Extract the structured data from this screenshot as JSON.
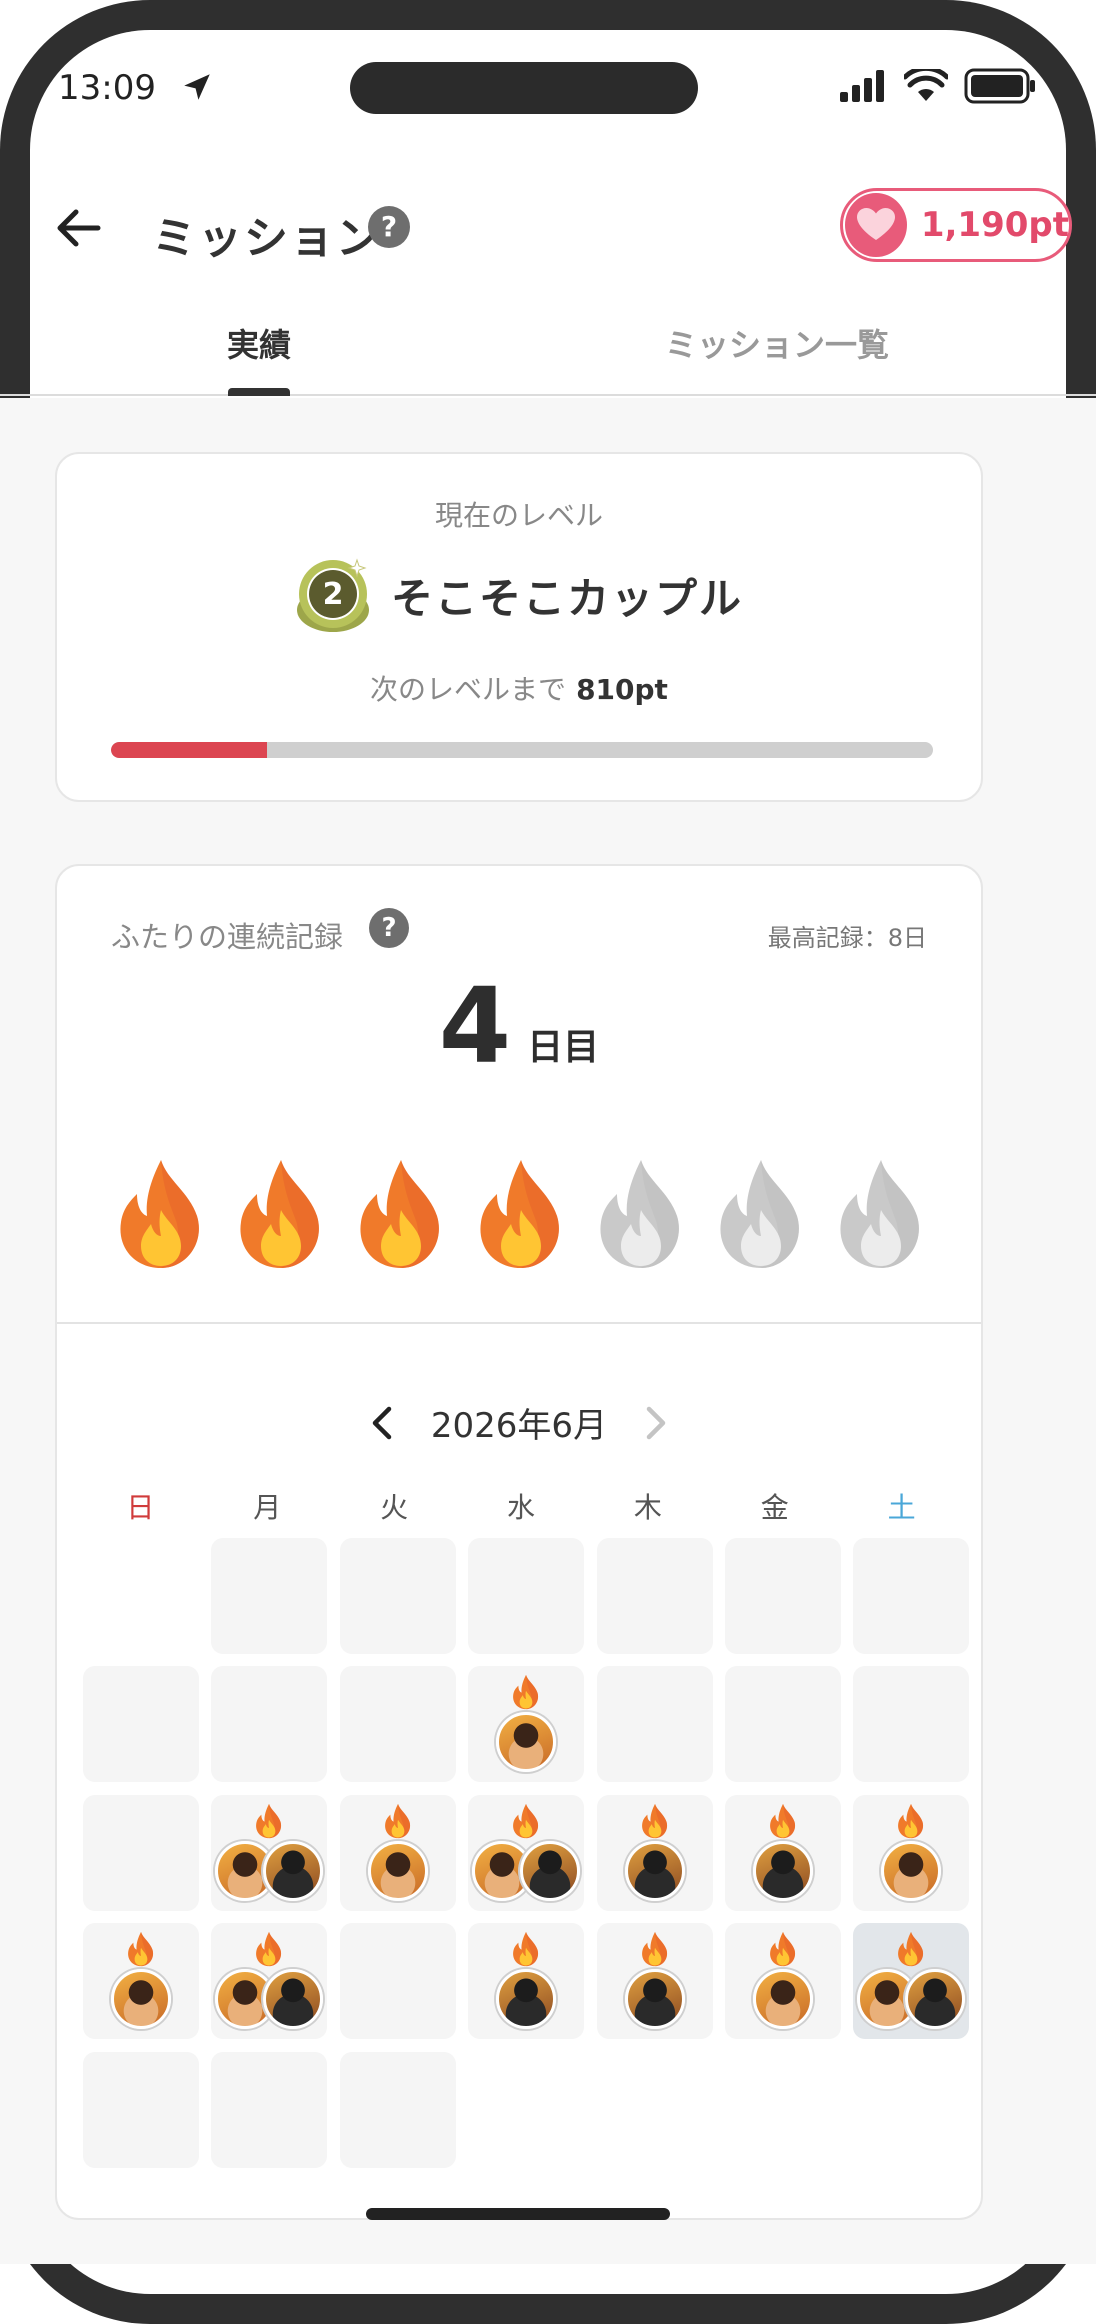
{
  "status_bar": {
    "time": "13:09"
  },
  "header": {
    "title": "ミッション",
    "help_glyph": "?",
    "points": "1,190pt"
  },
  "tabs": [
    {
      "label": "実績",
      "active": true
    },
    {
      "label": "ミッション一覧",
      "active": false
    }
  ],
  "level": {
    "caption": "現在のレベル",
    "number": "2",
    "name": "そこそこカップル",
    "next_label": "次のレベルまで",
    "next_value": "810pt",
    "progress_fraction": 0.19
  },
  "streak": {
    "label": "ふたりの連続記録",
    "help_glyph": "?",
    "best_record": "最高記録：8日",
    "count": "4",
    "unit": "日目",
    "flames": [
      true,
      true,
      true,
      true,
      false,
      false,
      false
    ]
  },
  "calendar": {
    "title": "2026年6月",
    "weekdays": [
      "日",
      "月",
      "火",
      "水",
      "木",
      "金",
      "土"
    ],
    "weeks": [
      [
        null,
        {
          "flame": false,
          "avatars": []
        },
        {
          "flame": false,
          "avatars": []
        },
        {
          "flame": false,
          "avatars": []
        },
        {
          "flame": false,
          "avatars": []
        },
        {
          "flame": false,
          "avatars": []
        },
        {
          "flame": false,
          "avatars": []
        }
      ],
      [
        {
          "flame": false,
          "avatars": []
        },
        {
          "flame": false,
          "avatars": []
        },
        {
          "flame": false,
          "avatars": []
        },
        {
          "flame": true,
          "avatars": [
            "f"
          ]
        },
        {
          "flame": false,
          "avatars": []
        },
        {
          "flame": false,
          "avatars": []
        },
        {
          "flame": false,
          "avatars": []
        }
      ],
      [
        {
          "flame": false,
          "avatars": []
        },
        {
          "flame": true,
          "avatars": [
            "f",
            "m"
          ]
        },
        {
          "flame": true,
          "avatars": [
            "f"
          ]
        },
        {
          "flame": true,
          "avatars": [
            "f",
            "m"
          ]
        },
        {
          "flame": true,
          "avatars": [
            "m"
          ]
        },
        {
          "flame": true,
          "avatars": [
            "m"
          ]
        },
        {
          "flame": true,
          "avatars": [
            "f"
          ]
        }
      ],
      [
        {
          "flame": true,
          "avatars": [
            "f"
          ]
        },
        {
          "flame": true,
          "avatars": [
            "f",
            "m"
          ]
        },
        {
          "flame": false,
          "avatars": []
        },
        {
          "flame": true,
          "avatars": [
            "m"
          ]
        },
        {
          "flame": true,
          "avatars": [
            "m"
          ]
        },
        {
          "flame": true,
          "avatars": [
            "f"
          ]
        },
        {
          "flame": true,
          "avatars": [
            "f",
            "m"
          ],
          "today": true
        }
      ],
      [
        {
          "flame": false,
          "avatars": []
        },
        {
          "flame": false,
          "avatars": []
        },
        {
          "flame": false,
          "avatars": []
        },
        null,
        null,
        null,
        null
      ]
    ]
  },
  "colors": {
    "accent_pink": "#e85b7a",
    "progress_red": "#dc4551",
    "flame_active": "#f07a2a",
    "flame_inactive": "#c8c8c8",
    "sunday": "#d03b3b",
    "saturday": "#4aa7d8"
  },
  "icons": {
    "back": "arrow-left-icon",
    "location": "location-arrow-icon",
    "signal": "signal-icon",
    "wifi": "wifi-icon",
    "battery": "battery-icon",
    "heart": "heart-icon",
    "flame": "flame-icon"
  }
}
